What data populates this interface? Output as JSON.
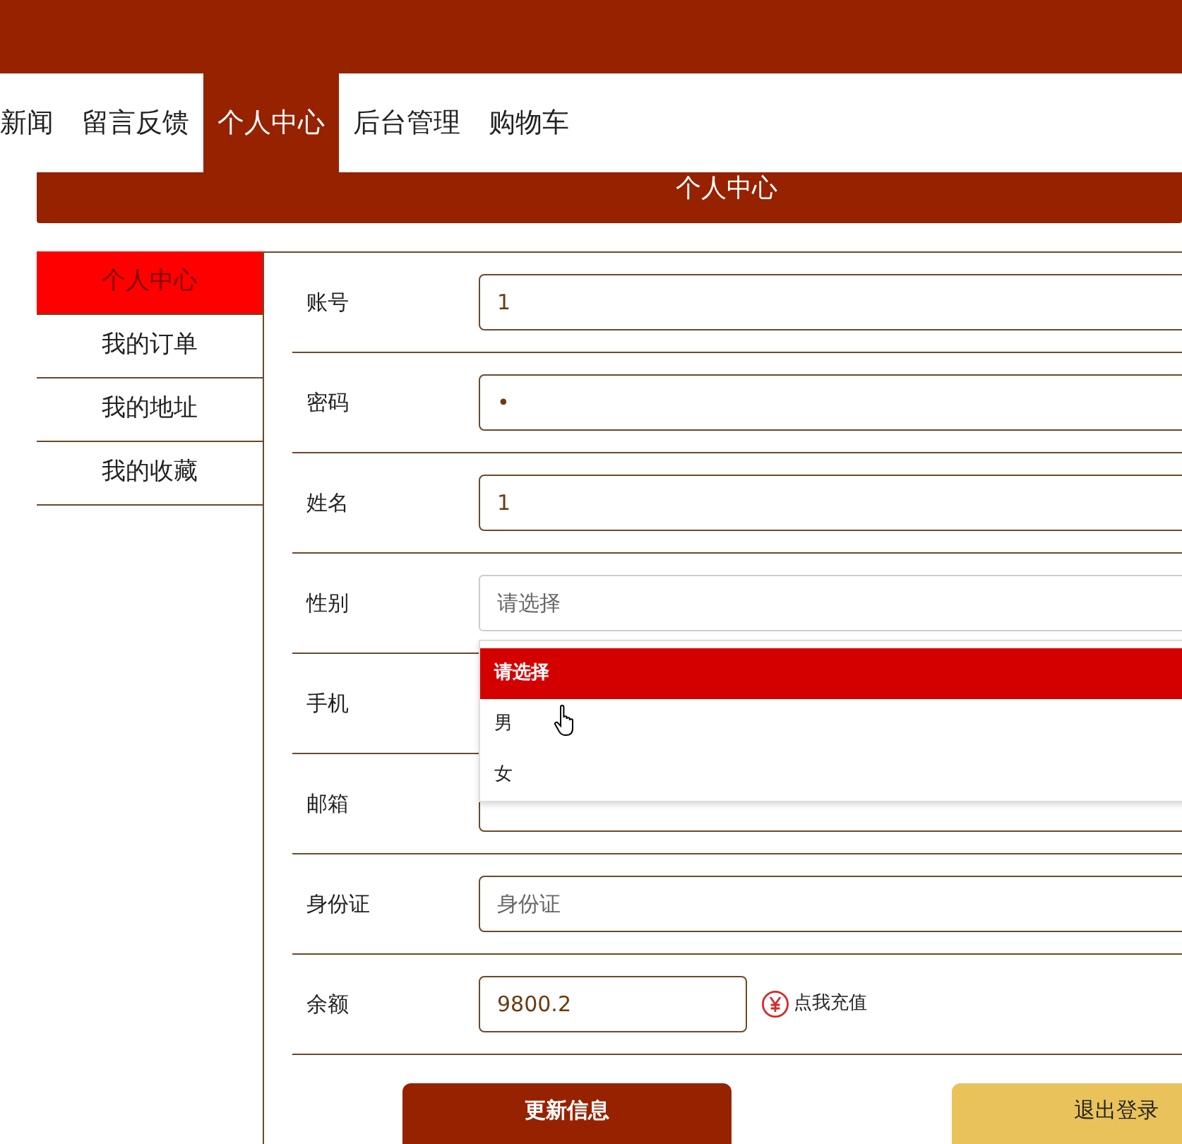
{
  "nav": [
    {
      "label": "新闻",
      "selected": false
    },
    {
      "label": "留言反馈",
      "selected": false
    },
    {
      "label": "个人中心",
      "selected": true
    },
    {
      "label": "后台管理",
      "selected": false
    },
    {
      "label": "购物车",
      "selected": false
    }
  ],
  "header": {
    "title": "个人中心"
  },
  "sidebar": {
    "items": [
      {
        "label": "个人中心",
        "selected": true
      },
      {
        "label": "我的订单",
        "selected": false
      },
      {
        "label": "我的地址",
        "selected": false
      },
      {
        "label": "我的收藏",
        "selected": false
      }
    ]
  },
  "form": {
    "fields": [
      {
        "kind": "text",
        "label": "账号",
        "value": "1"
      },
      {
        "kind": "text",
        "label": "密码",
        "value": "•"
      },
      {
        "kind": "text",
        "label": "姓名",
        "value": "1"
      },
      {
        "kind": "select",
        "label": "性别",
        "placeholder": "请选择",
        "expanded": true,
        "options": [
          {
            "label": "请选择",
            "selected": true
          },
          {
            "label": "男",
            "selected": false
          },
          {
            "label": "女",
            "selected": false
          }
        ]
      },
      {
        "kind": "label",
        "label": "手机"
      },
      {
        "kind": "text",
        "label": "邮箱"
      },
      {
        "kind": "text",
        "label": "身份证",
        "placeholder": "身份证"
      },
      {
        "kind": "balance",
        "label": "余额",
        "value": "9800.2",
        "link": "点我充值"
      }
    ]
  },
  "buttons": [
    {
      "label": "更新信息",
      "kind": "primary"
    },
    {
      "label": "退出登录",
      "kind": "secondary"
    }
  ]
}
